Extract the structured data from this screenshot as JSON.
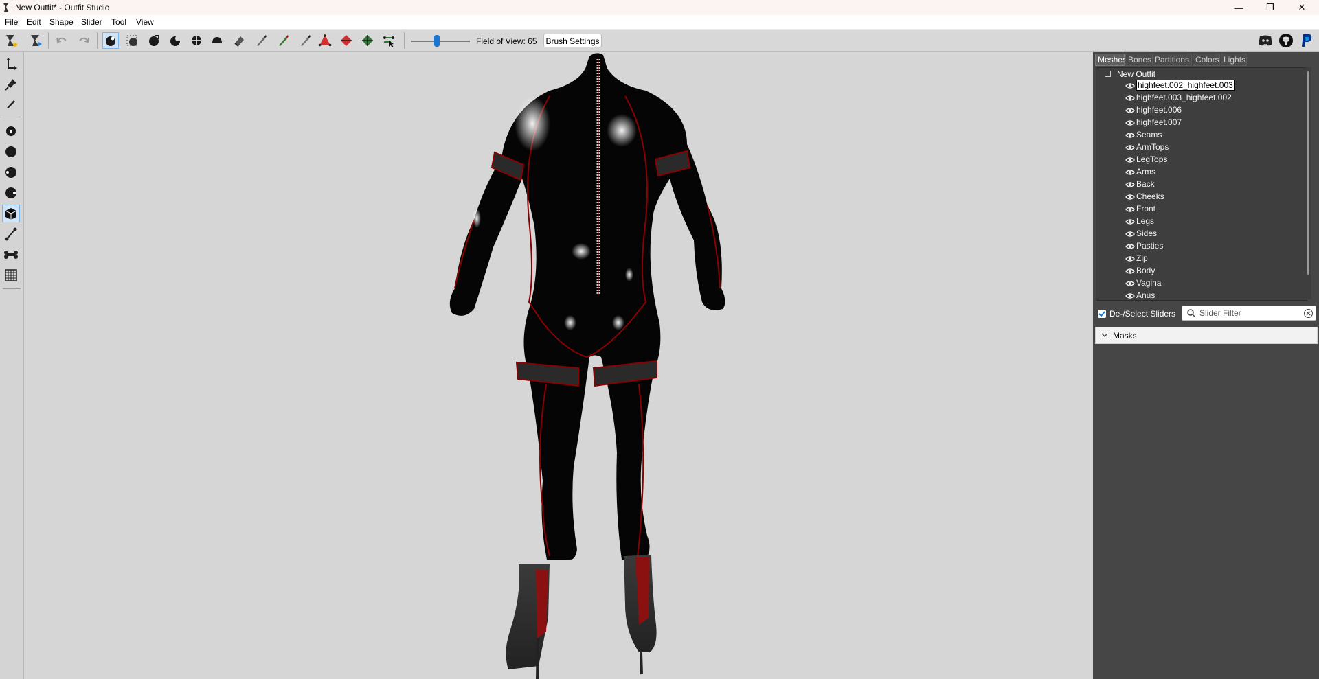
{
  "window": {
    "title": "New Outfit* - Outfit Studio"
  },
  "menu": [
    "File",
    "Edit",
    "Shape",
    "Slider",
    "Tool",
    "View"
  ],
  "toolbar": {
    "fov_label": "Field of View: 65",
    "brush_settings_label": "Brush Settings",
    "fov_slider_fraction": 0.46
  },
  "panel": {
    "tabs": [
      "Meshes",
      "Bones",
      "Partitions",
      "Colors",
      "Lights"
    ],
    "active_tab": "Meshes",
    "tree_root": "New Outfit",
    "meshes": [
      "highfeet.002_highfeet.003",
      "highfeet.003_highfeet.002",
      "highfeet.006",
      "highfeet.007",
      "Seams",
      "ArmTops",
      "LegTops",
      "Arms",
      "Back",
      "Cheeks",
      "Front",
      "Legs",
      "Sides",
      "Pasties",
      "Zip",
      "Body",
      "Vagina",
      "Anus"
    ],
    "selected_mesh": "highfeet.002_highfeet.003",
    "deselect_sliders_label": "De-/Select Sliders",
    "deselect_sliders_checked": true,
    "slider_filter_placeholder": "Slider Filter",
    "masks_label": "Masks"
  },
  "colors": {
    "viewport_bg": "#d6d6d6",
    "panel_bg": "#464646",
    "accent": "#1976d2",
    "suit": "#050505",
    "seam": "#8b0000"
  }
}
